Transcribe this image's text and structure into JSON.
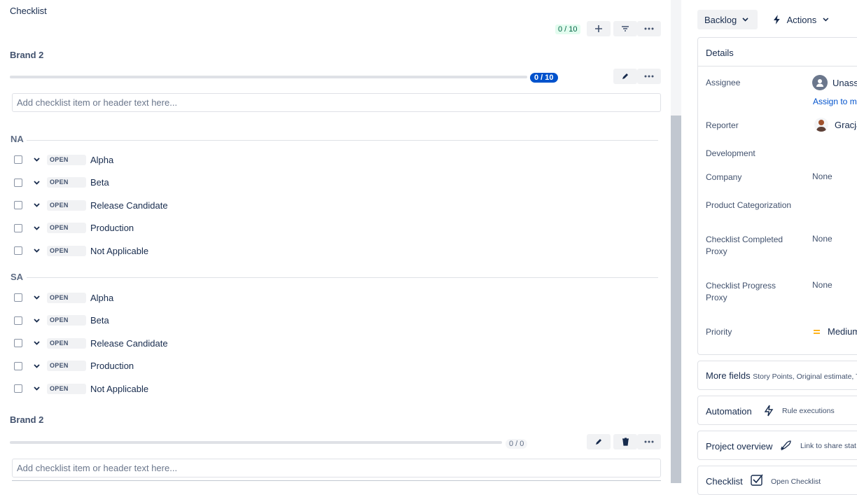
{
  "checklist": {
    "title": "Checklist",
    "overall_count": "0 / 10",
    "toolbar_icons": [
      "plus-icon",
      "filter-icon",
      "more-icon"
    ]
  },
  "brand1": {
    "title": "Brand 2",
    "progress_label": "0 / 10",
    "progress": 0,
    "add_placeholder": "Add checklist item or header text here..."
  },
  "sections": [
    {
      "name": "NA",
      "items": [
        {
          "status": "OPEN",
          "label": "Alpha"
        },
        {
          "status": "OPEN",
          "label": "Beta"
        },
        {
          "status": "OPEN",
          "label": "Release Candidate"
        },
        {
          "status": "OPEN",
          "label": "Production"
        },
        {
          "status": "OPEN",
          "label": "Not Applicable"
        }
      ]
    },
    {
      "name": "SA",
      "items": [
        {
          "status": "OPEN",
          "label": "Alpha"
        },
        {
          "status": "OPEN",
          "label": "Beta"
        },
        {
          "status": "OPEN",
          "label": "Release Candidate"
        },
        {
          "status": "OPEN",
          "label": "Production"
        },
        {
          "status": "OPEN",
          "label": "Not Applicable"
        }
      ]
    }
  ],
  "brand2": {
    "title": "Brand 2",
    "progress_label": "0 / 0",
    "progress": 0,
    "add_placeholder": "Add checklist item or header text here..."
  },
  "right": {
    "status_button": "Backlog",
    "actions_button": "Actions",
    "details_title": "Details",
    "fields": {
      "assignee_label": "Assignee",
      "assignee_value": "Unassi",
      "assign_to_me": "Assign to m",
      "reporter_label": "Reporter",
      "reporter_value": "Gracja",
      "development_label": "Development",
      "company_label": "Company",
      "company_value": "None",
      "product_cat_label": "Product Categorization",
      "checklist_completed_label_1": "Checklist Completed",
      "checklist_completed_label_2": "Proxy",
      "checklist_completed_value": "None",
      "checklist_progress_label_1": "Checklist Progress",
      "checklist_progress_label_2": "Proxy",
      "checklist_progress_value": "None",
      "priority_label": "Priority",
      "priority_value": "Medium"
    },
    "more_fields_title": "More fields",
    "more_fields_sub": "Story Points, Original estimate, T",
    "automation_title": "Automation",
    "automation_sub": "Rule executions",
    "project_overview_title": "Project overview",
    "project_overview_sub": "Link to share stat",
    "checklist_card_title": "Checklist",
    "checklist_card_sub": "Open Checklist",
    "colors": {
      "accent": "#0052cc",
      "priority": "#ffab00",
      "success_bg": "#e3fcef"
    }
  }
}
